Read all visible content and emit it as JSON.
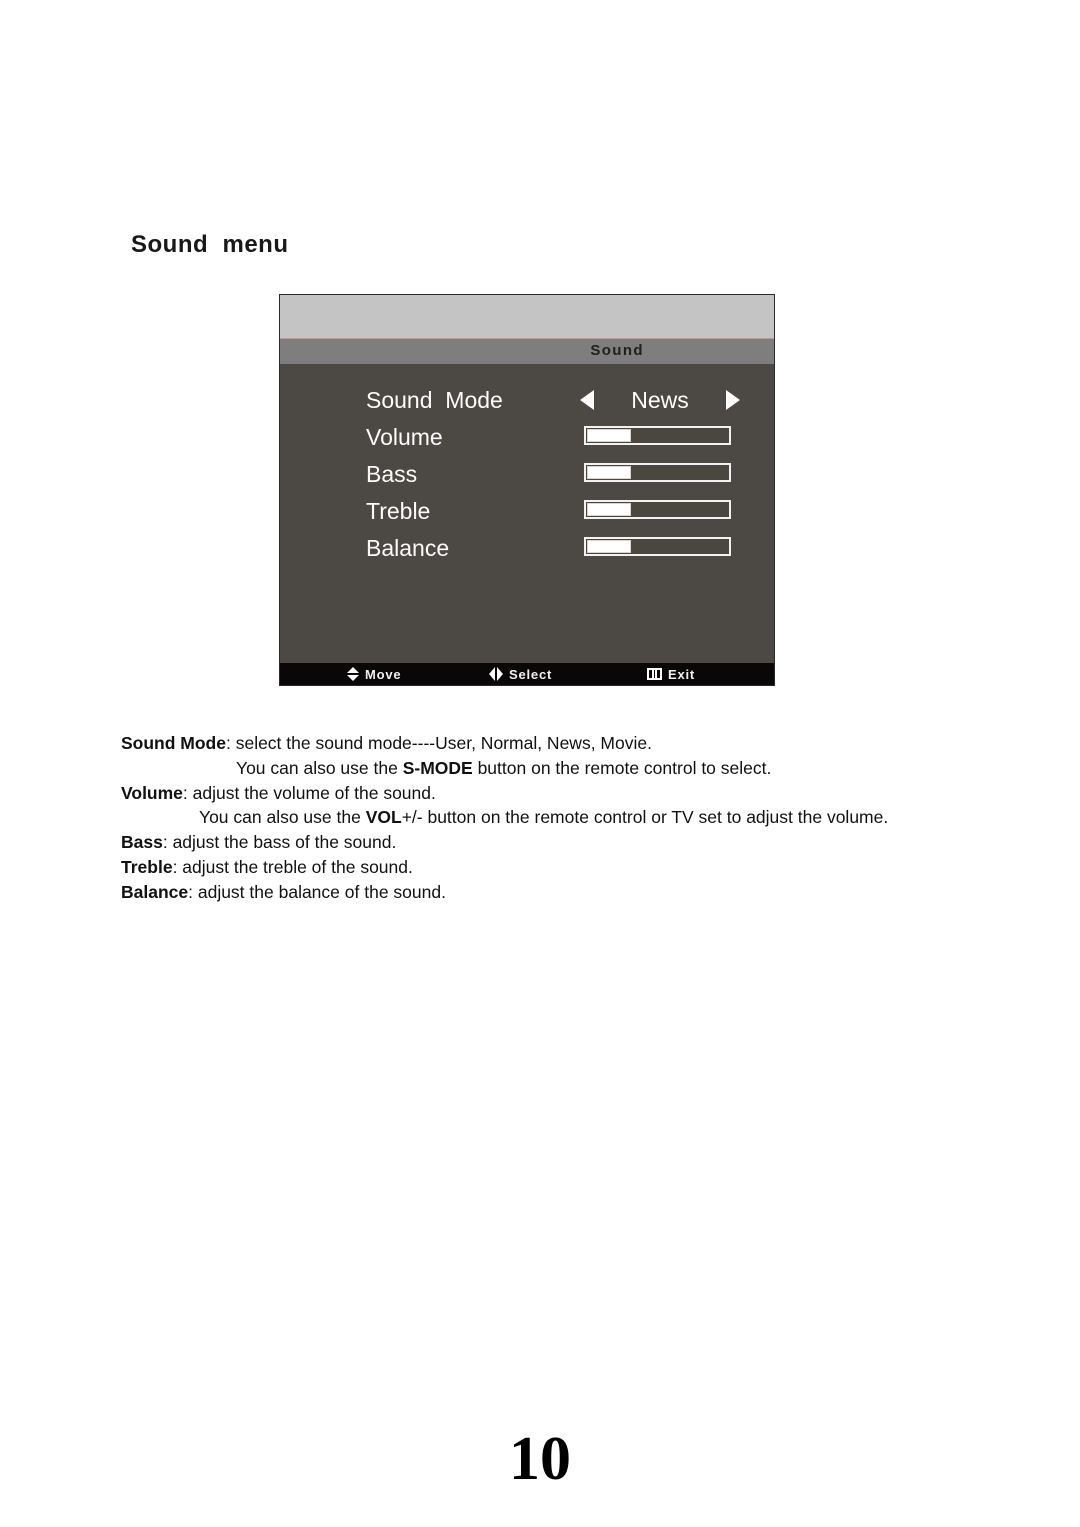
{
  "page": {
    "heading": "Sound  menu",
    "number": "10"
  },
  "osd": {
    "title": "Sound",
    "colors": {
      "top_band": "#c4c4c4",
      "title_bar": "#7e7e7e",
      "body": "#4c4843",
      "footer": "#0a0708",
      "text": "#ffffff"
    },
    "rows": [
      {
        "label": "Sound  Mode",
        "control": "picker",
        "value": "News",
        "arrow_left": "triangle-left-icon",
        "arrow_right": "triangle-right-icon"
      },
      {
        "label": "Volume",
        "control": "slider",
        "fill_percent": 31
      },
      {
        "label": "Bass",
        "control": "slider",
        "fill_percent": 31
      },
      {
        "label": "Treble",
        "control": "slider",
        "fill_percent": 31
      },
      {
        "label": "Balance",
        "control": "slider",
        "fill_percent": 31
      }
    ],
    "footer": [
      {
        "icon": "up-down-arrows-icon",
        "label": "Move"
      },
      {
        "icon": "left-right-arrows-icon",
        "label": "Select"
      },
      {
        "icon": "menu-button-icon",
        "label": "Exit"
      }
    ]
  },
  "description": {
    "lines": [
      {
        "term": "Sound Mode",
        "rest": ": select the sound mode----User, Normal, News, Movie.",
        "indent": "none"
      },
      {
        "pre": "You can also use the ",
        "term": "S-MODE",
        "rest": " button on the remote control to select.",
        "indent": "deep"
      },
      {
        "term": "Volume",
        "rest": ": adjust the volume of the sound.",
        "indent": "none"
      },
      {
        "pre": "You can also use the ",
        "term": "VOL",
        "rest": "+/- button on the remote control or TV set to adjust the volume.",
        "indent": "mid"
      },
      {
        "term": "Bass",
        "rest": ": adjust the bass of the sound.",
        "indent": "none"
      },
      {
        "term": "Treble",
        "rest": ": adjust the treble of the sound.",
        "indent": "none"
      },
      {
        "term": "Balance",
        "rest": ": adjust the balance of the sound.",
        "indent": "none"
      }
    ]
  }
}
